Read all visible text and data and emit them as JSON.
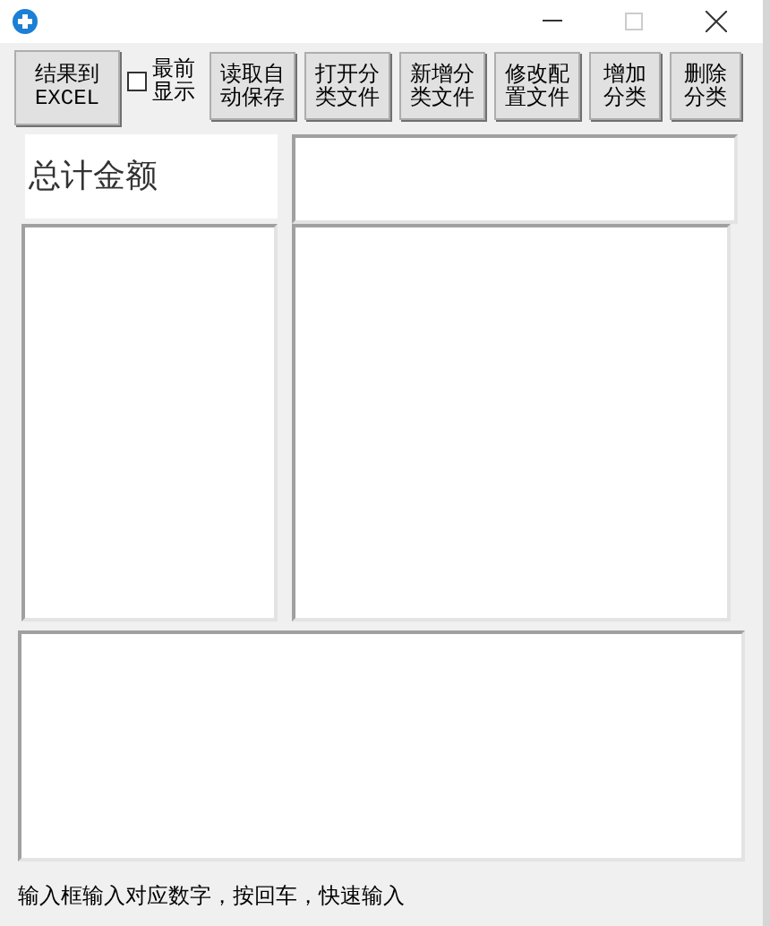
{
  "toolbar": {
    "buttons": [
      {
        "label": "结果到EXCEL",
        "kind": "tall"
      },
      {
        "label": "读取自动保存",
        "kind": "normal"
      },
      {
        "label": "打开分类文件",
        "kind": "normal"
      },
      {
        "label": "新增分类文件",
        "kind": "normal"
      },
      {
        "label": "修改配置文件",
        "kind": "normal"
      },
      {
        "label": "增加分类",
        "kind": "narrow"
      },
      {
        "label": "删除分类",
        "kind": "narrow"
      }
    ],
    "topmost": {
      "label": "最前显示",
      "checked": false
    }
  },
  "total_label": "总计金额",
  "status_bar": "输入框输入对应数字，按回车，快速输入"
}
